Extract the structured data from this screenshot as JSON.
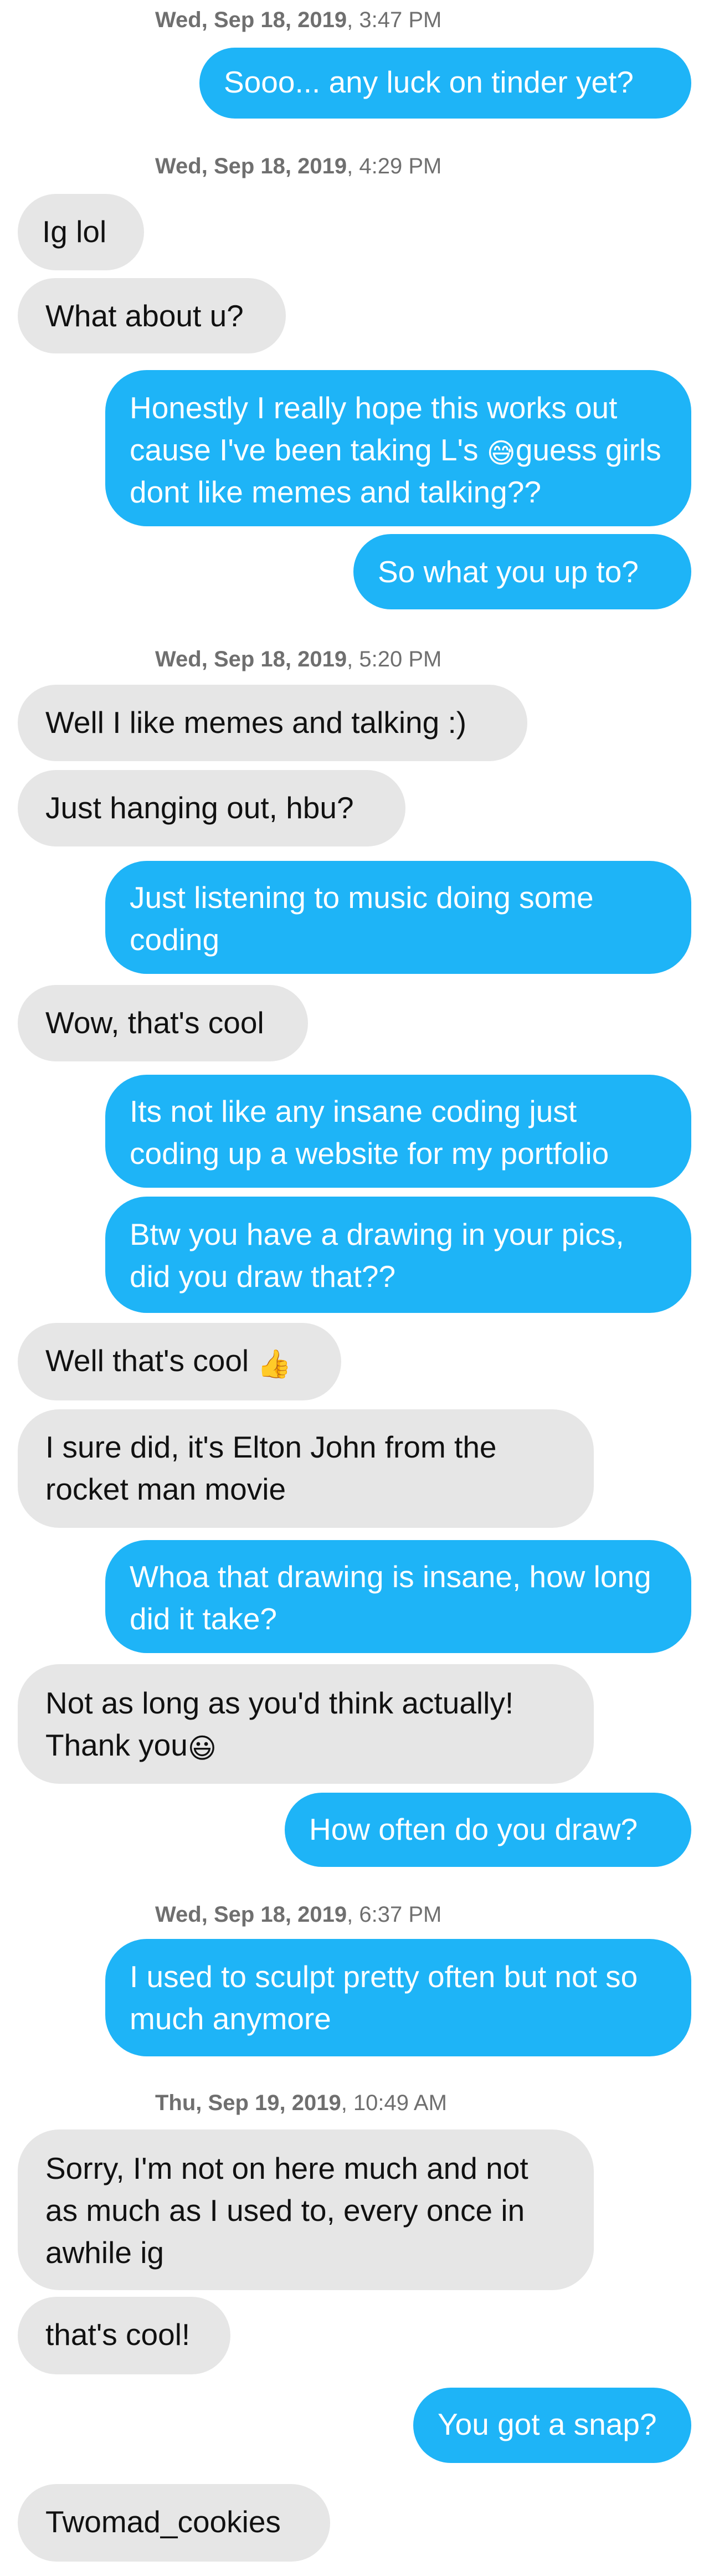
{
  "colors": {
    "incoming_bubble": "#e6e6e6",
    "outgoing_bubble": "#1eb4f7",
    "incoming_text": "#111111",
    "outgoing_text": "#ffffff",
    "timestamp_text": "#6f6f6f",
    "background": "#ffffff"
  },
  "timestamps": [
    {
      "date": "Wed, Sep 18, 2019",
      "time": ", 3:47 PM"
    },
    {
      "date": "Wed, Sep 18, 2019",
      "time": ", 4:29 PM"
    },
    {
      "date": "Wed, Sep 18, 2019",
      "time": ", 5:20 PM"
    },
    {
      "date": "Wed, Sep 18, 2019",
      "time": ", 6:37 PM"
    },
    {
      "date": "Thu, Sep 19, 2019",
      "time": ", 10:49 AM"
    }
  ],
  "messages": [
    {
      "from": "me",
      "text": "Sooo... any luck on tinder yet?"
    },
    {
      "from": "them",
      "text": "Ig lol"
    },
    {
      "from": "them",
      "text": "What about u?"
    },
    {
      "from": "me",
      "text_before": "Honestly I really hope this works out cause I've been taking L's ",
      "emoji": "😅",
      "emoji_name": "grinning-sweat-emoji",
      "text_after": "guess girls dont like memes and talking??"
    },
    {
      "from": "me",
      "text": "So what you up to?"
    },
    {
      "from": "them",
      "text": "Well I like memes and talking :)"
    },
    {
      "from": "them",
      "text": "Just hanging out, hbu?"
    },
    {
      "from": "me",
      "text": "Just listening to music doing some coding"
    },
    {
      "from": "them",
      "text": "Wow, that's cool"
    },
    {
      "from": "me",
      "text": "Its not like any insane coding just coding up a website for my portfolio"
    },
    {
      "from": "me",
      "text": "Btw you have a drawing in your pics, did you draw that??"
    },
    {
      "from": "them",
      "text_before": "Well that's cool ",
      "emoji": "👍",
      "emoji_name": "thumbs-up-emoji",
      "text_after": ""
    },
    {
      "from": "them",
      "text": "I sure did, it's Elton John from the rocket man movie"
    },
    {
      "from": "me",
      "text": "Whoa that drawing is insane, how long did it take?"
    },
    {
      "from": "them",
      "text_before": "Not as long as you'd think actually! Thank you",
      "emoji": "😃",
      "emoji_name": "smiley-emoji",
      "text_after": ""
    },
    {
      "from": "me",
      "text": "How often do you draw?"
    },
    {
      "from": "me",
      "text": "I used to sculpt pretty often but not so much anymore"
    },
    {
      "from": "them",
      "text": "Sorry, I'm not on here much and not as much as I used to, every once in awhile ig"
    },
    {
      "from": "them",
      "text": "that's cool!"
    },
    {
      "from": "me",
      "text": "You got a snap?"
    },
    {
      "from": "them",
      "text": "Twomad_cookies"
    }
  ]
}
